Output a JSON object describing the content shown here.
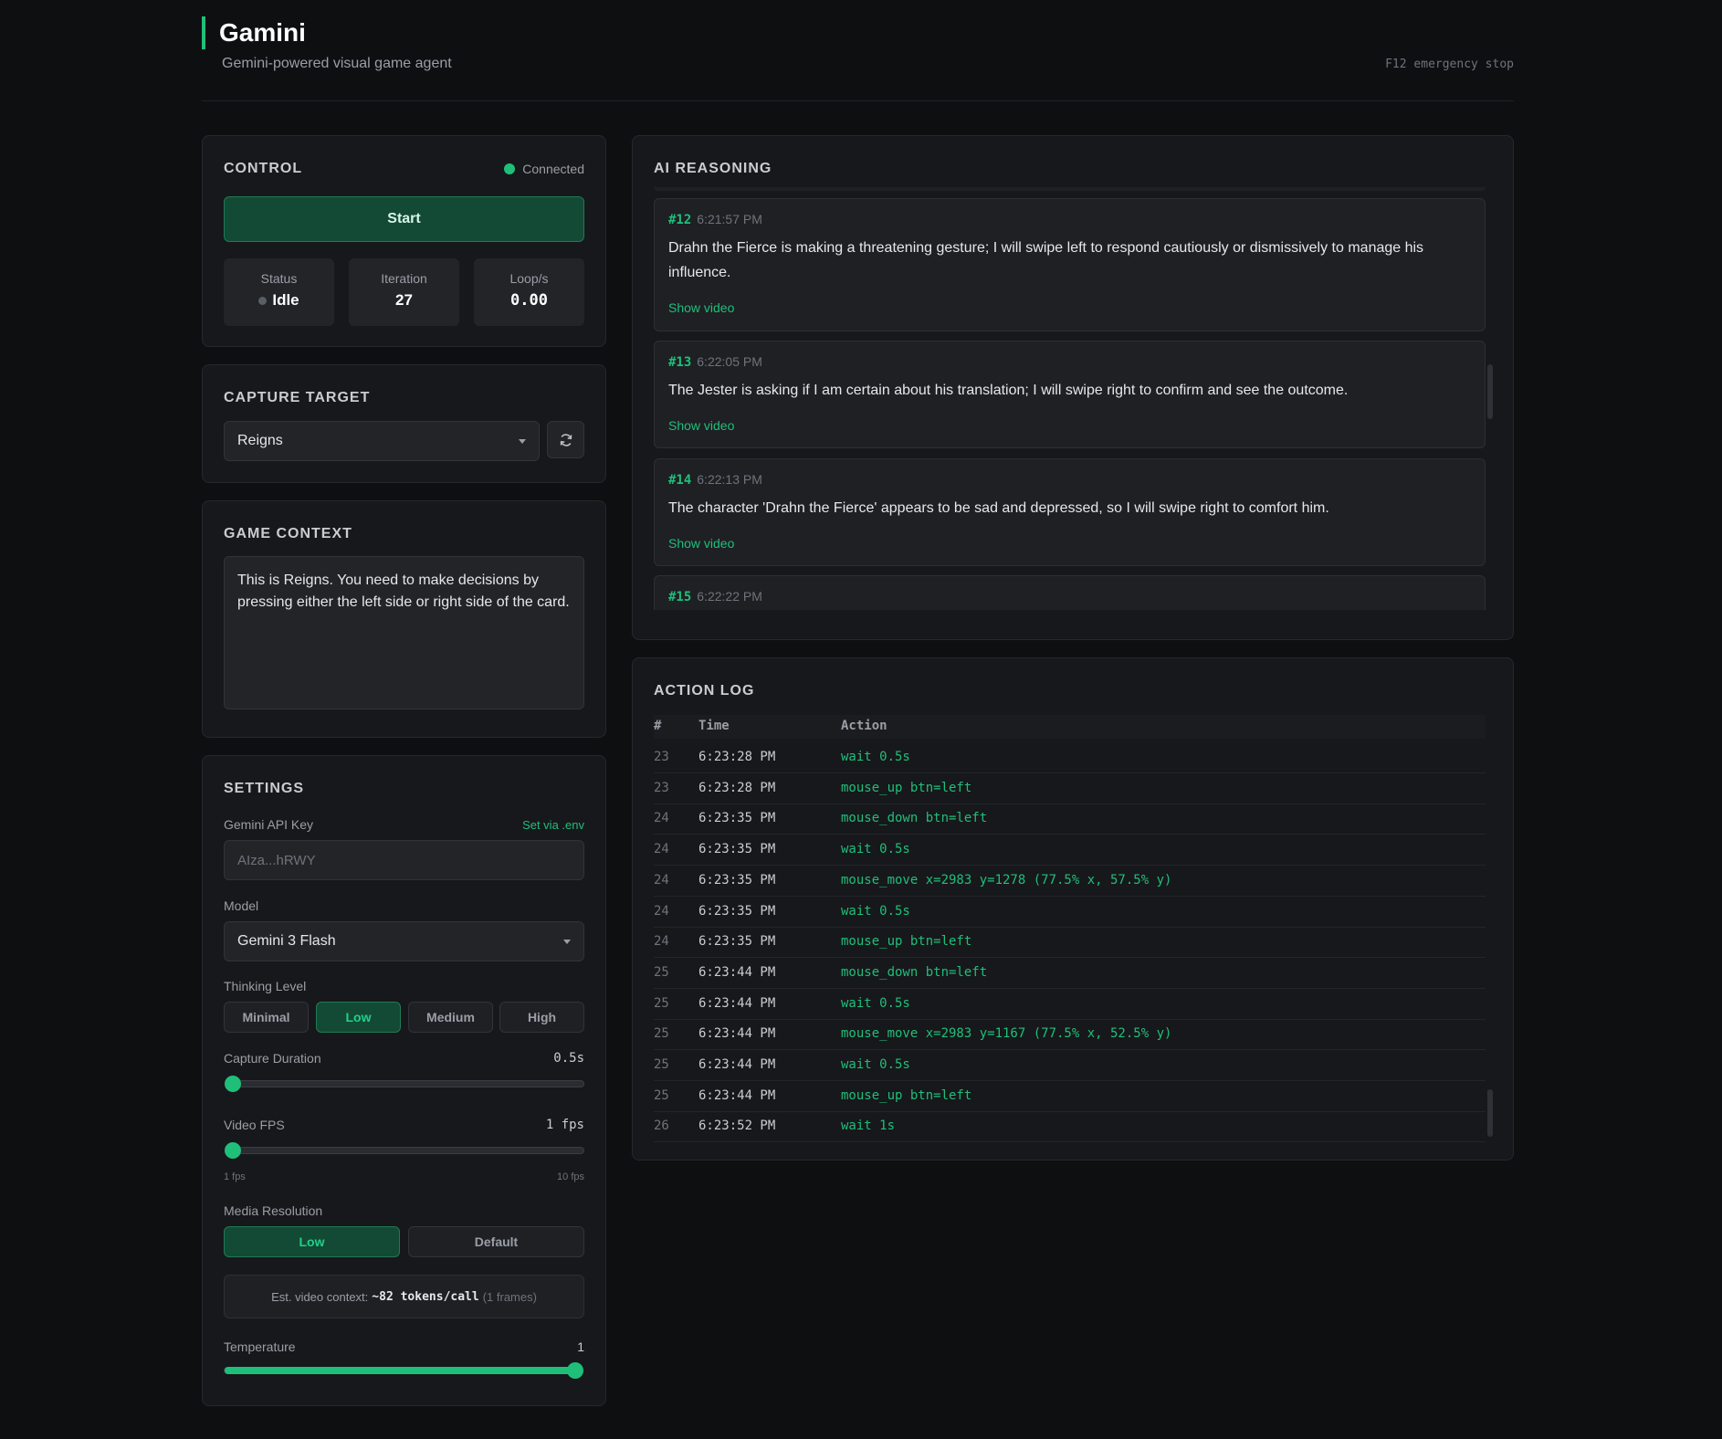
{
  "header": {
    "title": "Gamini",
    "subtitle": "Gemini-powered visual game agent",
    "emergency_stop": "F12 emergency stop"
  },
  "control": {
    "title": "CONTROL",
    "connection": "Connected",
    "start_label": "Start",
    "stats": [
      {
        "label": "Status",
        "value": "Idle"
      },
      {
        "label": "Iteration",
        "value": "27"
      },
      {
        "label": "Loop/s",
        "value": "0.00"
      }
    ]
  },
  "capture": {
    "title": "CAPTURE TARGET",
    "selected": "Reigns",
    "refresh_icon": "refresh-icon"
  },
  "context": {
    "title": "GAME CONTEXT",
    "text": "This is Reigns. You need to make decisions by pressing either the left side or right side of the card."
  },
  "settings": {
    "title": "SETTINGS",
    "api_key_label": "Gemini API Key",
    "api_key_hint": "Set via .env",
    "api_key_placeholder": "AIza...hRWY",
    "model_label": "Model",
    "model_value": "Gemini 3 Flash",
    "thinking_label": "Thinking Level",
    "thinking_options": [
      "Minimal",
      "Low",
      "Medium",
      "High"
    ],
    "thinking_selected": "Low",
    "capture_duration_label": "Capture Duration",
    "capture_duration_value": "0.5s",
    "capture_duration_fraction": 0.0,
    "video_fps_label": "Video FPS",
    "video_fps_value": "1 fps",
    "video_fps_fraction": 0.0,
    "fps_min": "1 fps",
    "fps_max": "10 fps",
    "media_res_label": "Media Resolution",
    "media_res_options": [
      "Low",
      "Default"
    ],
    "media_res_selected": "Low",
    "est_prefix": "Est. video context:",
    "est_tokens": "~82 tokens/call",
    "est_frames": "(1 frames)",
    "temperature_label": "Temperature",
    "temperature_value": "1",
    "temperature_fraction": 1.0
  },
  "reasoning": {
    "title": "AI REASONING",
    "entries": [
      {
        "num": "#12",
        "time": "6:21:57 PM",
        "text": "Drahn the Fierce is making a threatening gesture; I will swipe left to respond cautiously or dismissively to manage his influence.",
        "link": "Show video"
      },
      {
        "num": "#13",
        "time": "6:22:05 PM",
        "text": "The Jester is asking if I am certain about his translation; I will swipe right to confirm and see the outcome.",
        "link": "Show video"
      },
      {
        "num": "#14",
        "time": "6:22:13 PM",
        "text": "The character 'Drahn the Fierce' appears to be sad and depressed, so I will swipe right to comfort him.",
        "link": "Show video"
      },
      {
        "num": "#15",
        "time": "6:22:22 PM",
        "text": "",
        "link": ""
      }
    ]
  },
  "actionlog": {
    "title": "ACTION LOG",
    "columns": [
      "#",
      "Time",
      "Action"
    ],
    "rows": [
      [
        "23",
        "6:23:28 PM",
        "wait 0.5s"
      ],
      [
        "23",
        "6:23:28 PM",
        "mouse_up btn=left"
      ],
      [
        "24",
        "6:23:35 PM",
        "mouse_down btn=left"
      ],
      [
        "24",
        "6:23:35 PM",
        "wait 0.5s"
      ],
      [
        "24",
        "6:23:35 PM",
        "mouse_move x=2983 y=1278 (77.5% x, 57.5% y)"
      ],
      [
        "24",
        "6:23:35 PM",
        "wait 0.5s"
      ],
      [
        "24",
        "6:23:35 PM",
        "mouse_up btn=left"
      ],
      [
        "25",
        "6:23:44 PM",
        "mouse_down btn=left"
      ],
      [
        "25",
        "6:23:44 PM",
        "wait 0.5s"
      ],
      [
        "25",
        "6:23:44 PM",
        "mouse_move x=2983 y=1167 (77.5% x, 52.5% y)"
      ],
      [
        "25",
        "6:23:44 PM",
        "wait 0.5s"
      ],
      [
        "25",
        "6:23:44 PM",
        "mouse_up btn=left"
      ],
      [
        "26",
        "6:23:52 PM",
        "wait 1s"
      ]
    ]
  },
  "colors": {
    "accent": "#1fbf7a",
    "background": "#0e0f11",
    "panel": "#17181b"
  }
}
